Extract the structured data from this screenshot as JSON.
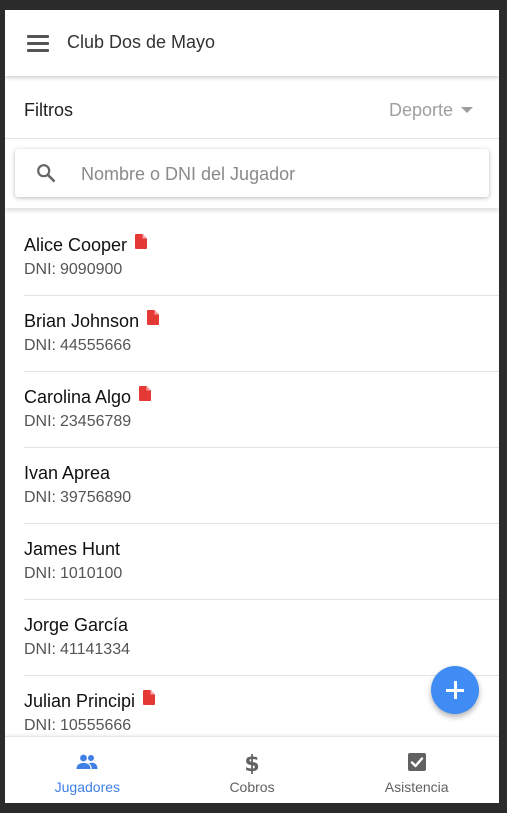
{
  "app_bar": {
    "title": "Club Dos de Mayo",
    "menu_icon": "menu-icon"
  },
  "filters": {
    "label": "Filtros",
    "sport_select": "Deporte"
  },
  "search": {
    "placeholder": "Nombre o DNI del Jugador",
    "value": "",
    "icon": "search-icon"
  },
  "players": [
    {
      "name": "Alice Cooper",
      "dni_label": "DNI:",
      "dni": "9090900",
      "has_document": true
    },
    {
      "name": "Brian Johnson",
      "dni_label": "DNI:",
      "dni": "44555666",
      "has_document": true
    },
    {
      "name": "Carolina Algo",
      "dni_label": "DNI:",
      "dni": "23456789",
      "has_document": true
    },
    {
      "name": "Ivan Aprea",
      "dni_label": "DNI:",
      "dni": "39756890",
      "has_document": false
    },
    {
      "name": "James Hunt",
      "dni_label": "DNI:",
      "dni": "1010100",
      "has_document": false
    },
    {
      "name": "Jorge García",
      "dni_label": "DNI:",
      "dni": "41141334",
      "has_document": false
    },
    {
      "name": "Julian Principi",
      "dni_label": "DNI:",
      "dni": "10555666",
      "has_document": true
    }
  ],
  "fab": {
    "icon": "add-icon"
  },
  "bottom_nav": {
    "tabs": [
      {
        "label": "Jugadores",
        "icon": "people-icon",
        "active": true
      },
      {
        "label": "Cobros",
        "icon": "dollar-icon",
        "active": false
      },
      {
        "label": "Asistencia",
        "icon": "check-box-icon",
        "active": false
      }
    ]
  },
  "colors": {
    "accent": "#3f8cf4",
    "active_tab": "#3f7fe6",
    "document_icon": "#e53935",
    "inactive_icon": "#616161"
  }
}
